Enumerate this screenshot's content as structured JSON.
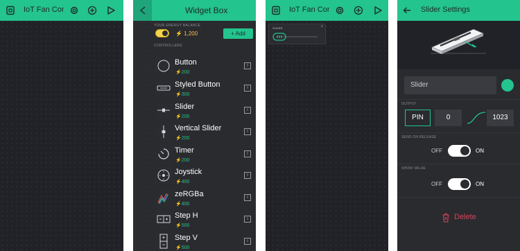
{
  "colors": {
    "accent": "#23c48e",
    "background": "#212227",
    "danger": "#d3435c",
    "energy": "#f5c542"
  },
  "phone1": {
    "title": "IoT Fan Contro",
    "icons": [
      "device-icon",
      "settings-icon",
      "add-icon",
      "play-icon"
    ]
  },
  "widget_box": {
    "title": "Widget Box",
    "energy_label": "YOUR ENERGY BALANCE",
    "balance": "1,200",
    "add_label": "+ Add",
    "controllers_label": "CONTROLLERS",
    "items": [
      {
        "name": "Button",
        "price": "200",
        "icon": "button-icon"
      },
      {
        "name": "Styled Button",
        "price": "300",
        "icon": "styled-button-icon"
      },
      {
        "name": "Slider",
        "price": "200",
        "icon": "slider-icon"
      },
      {
        "name": "Vertical Slider",
        "price": "200",
        "icon": "vertical-slider-icon"
      },
      {
        "name": "Timer",
        "price": "200",
        "icon": "timer-icon"
      },
      {
        "name": "Joystick",
        "price": "400",
        "icon": "joystick-icon"
      },
      {
        "name": "zeRGBa",
        "price": "400",
        "icon": "zergba-icon"
      },
      {
        "name": "Step H",
        "price": "500",
        "icon": "step-h-icon"
      },
      {
        "name": "Step V",
        "price": "500",
        "icon": "step-v-icon"
      }
    ],
    "info_glyph": "i"
  },
  "phone3": {
    "title": "IoT Fan Contro",
    "widget_label": "SLIDER",
    "widget_close": "×"
  },
  "settings": {
    "title": "Slider Settings",
    "name_value": "Slider",
    "output_label": "OUTPUT",
    "pin_label": "PIN",
    "min_value": "0",
    "max_value": "1023",
    "send_on_release_label": "SEND ON RELEASE",
    "show_value_label": "SHOW VALUE",
    "off_label": "OFF",
    "on_label": "ON",
    "delete_label": "Delete",
    "send_on_release_on": true,
    "show_value_on": true
  }
}
